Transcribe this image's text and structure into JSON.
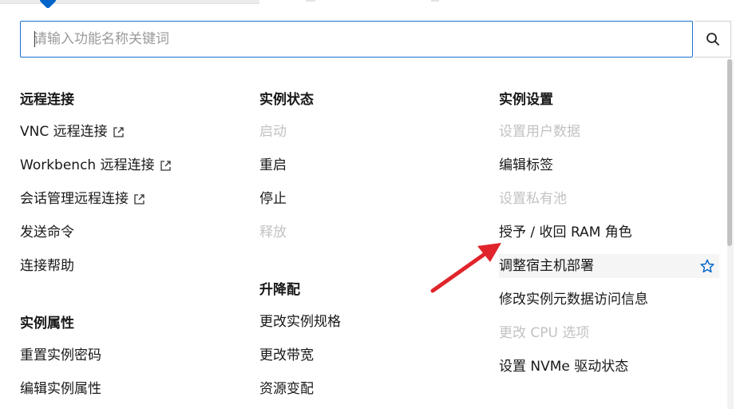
{
  "search": {
    "placeholder": "请输入功能名称关键词"
  },
  "columns": [
    {
      "groups": [
        {
          "title": "远程连接",
          "items": [
            {
              "label": "VNC 远程连接",
              "external": true,
              "disabled": false
            },
            {
              "label": "Workbench 远程连接",
              "external": true,
              "disabled": false
            },
            {
              "label": "会话管理远程连接",
              "external": true,
              "disabled": false
            },
            {
              "label": "发送命令",
              "external": false,
              "disabled": false
            },
            {
              "label": "连接帮助",
              "external": false,
              "disabled": false
            }
          ]
        },
        {
          "title": "实例属性",
          "items": [
            {
              "label": "重置实例密码",
              "disabled": false
            },
            {
              "label": "编辑实例属性",
              "disabled": false
            }
          ]
        }
      ]
    },
    {
      "groups": [
        {
          "title": "实例状态",
          "items": [
            {
              "label": "启动",
              "disabled": true
            },
            {
              "label": "重启",
              "disabled": false
            },
            {
              "label": "停止",
              "disabled": false
            },
            {
              "label": "释放",
              "disabled": true
            }
          ]
        },
        {
          "title": "升降配",
          "items": [
            {
              "label": "更改实例规格",
              "disabled": false
            },
            {
              "label": "更改带宽",
              "disabled": false
            },
            {
              "label": "资源变配",
              "disabled": false
            }
          ]
        }
      ]
    },
    {
      "groups": [
        {
          "title": "实例设置",
          "items": [
            {
              "label": "设置用户数据",
              "disabled": true
            },
            {
              "label": "编辑标签",
              "disabled": false
            },
            {
              "label": "设置私有池",
              "disabled": true
            },
            {
              "label": "授予 / 收回 RAM 角色",
              "disabled": false
            },
            {
              "label": "调整宿主机部署",
              "disabled": false,
              "favorite_icon": "star-outline-icon"
            },
            {
              "label": "修改实例元数据访问信息",
              "disabled": false
            },
            {
              "label": "更改 CPU 选项",
              "disabled": true
            },
            {
              "label": "设置 NVMe 驱动状态",
              "disabled": false
            }
          ]
        }
      ]
    }
  ],
  "icons": {
    "search": "search-icon",
    "external": "external-link-icon",
    "star": "star-outline-icon"
  },
  "colors": {
    "accent": "#0064c8",
    "disabled_text": "#c2c2c2",
    "annotation_arrow": "#e0242b"
  }
}
